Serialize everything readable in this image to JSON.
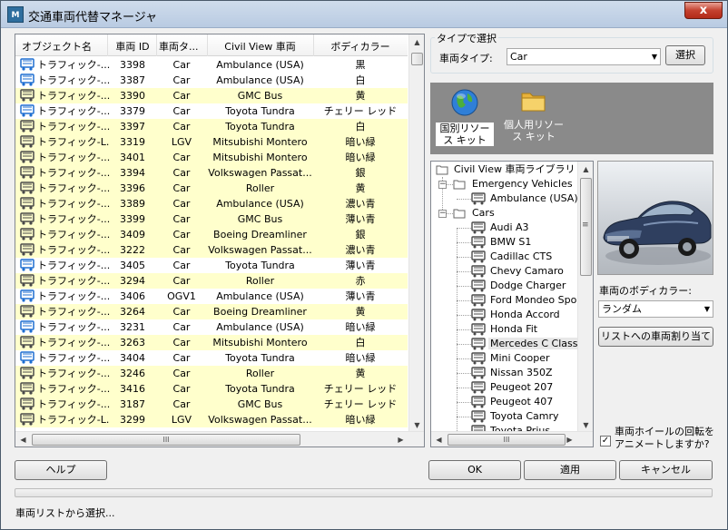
{
  "window": {
    "title": "交通車両代替マネージャ",
    "icon_text": "M",
    "close": "x"
  },
  "list": {
    "columns": [
      "オブジェクト名",
      "車両 ID",
      "車両タ...",
      "Civil View 車両",
      "ボディカラー"
    ],
    "rows": [
      {
        "name": "トラフィック-...",
        "id": "3398",
        "type": "Car",
        "civil": "Ambulance (USA)",
        "color": "黒",
        "hl": false,
        "icon": "blue"
      },
      {
        "name": "トラフィック-...",
        "id": "3387",
        "type": "Car",
        "civil": "Ambulance (USA)",
        "color": "白",
        "hl": false,
        "icon": "blue"
      },
      {
        "name": "トラフィック-...",
        "id": "3390",
        "type": "Car",
        "civil": "GMC Bus",
        "color": "黄",
        "hl": true,
        "icon": "gray"
      },
      {
        "name": "トラフィック-...",
        "id": "3379",
        "type": "Car",
        "civil": "Toyota Tundra",
        "color": "チェリー レッド",
        "hl": false,
        "icon": "blue"
      },
      {
        "name": "トラフィック-...",
        "id": "3397",
        "type": "Car",
        "civil": "Toyota Tundra",
        "color": "白",
        "hl": true,
        "icon": "gray"
      },
      {
        "name": "トラフィック-L...",
        "id": "3319",
        "type": "LGV",
        "civil": "Mitsubishi Montero",
        "color": "暗い緑",
        "hl": true,
        "icon": "gray"
      },
      {
        "name": "トラフィック-...",
        "id": "3401",
        "type": "Car",
        "civil": "Mitsubishi Montero",
        "color": "暗い緑",
        "hl": true,
        "icon": "gray"
      },
      {
        "name": "トラフィック-...",
        "id": "3394",
        "type": "Car",
        "civil": "Volkswagen Passat...",
        "color": "銀",
        "hl": true,
        "icon": "gray"
      },
      {
        "name": "トラフィック-...",
        "id": "3396",
        "type": "Car",
        "civil": "Roller",
        "color": "黄",
        "hl": true,
        "icon": "gray"
      },
      {
        "name": "トラフィック-...",
        "id": "3389",
        "type": "Car",
        "civil": "Ambulance (USA)",
        "color": "濃い青",
        "hl": true,
        "icon": "gray"
      },
      {
        "name": "トラフィック-...",
        "id": "3399",
        "type": "Car",
        "civil": "GMC Bus",
        "color": "薄い青",
        "hl": true,
        "icon": "gray"
      },
      {
        "name": "トラフィック-...",
        "id": "3409",
        "type": "Car",
        "civil": "Boeing Dreamliner",
        "color": "銀",
        "hl": true,
        "icon": "gray"
      },
      {
        "name": "トラフィック-...",
        "id": "3222",
        "type": "Car",
        "civil": "Volkswagen Passat...",
        "color": "濃い青",
        "hl": true,
        "icon": "gray"
      },
      {
        "name": "トラフィック-...",
        "id": "3405",
        "type": "Car",
        "civil": "Toyota Tundra",
        "color": "薄い青",
        "hl": false,
        "icon": "blue"
      },
      {
        "name": "トラフィック-...",
        "id": "3294",
        "type": "Car",
        "civil": "Roller",
        "color": "赤",
        "hl": true,
        "icon": "gray"
      },
      {
        "name": "トラフィック-...",
        "id": "3406",
        "type": "OGV1",
        "civil": "Ambulance (USA)",
        "color": "薄い青",
        "hl": false,
        "icon": "blue"
      },
      {
        "name": "トラフィック-...",
        "id": "3264",
        "type": "Car",
        "civil": "Boeing Dreamliner",
        "color": "黄",
        "hl": true,
        "icon": "gray"
      },
      {
        "name": "トラフィック-...",
        "id": "3231",
        "type": "Car",
        "civil": "Ambulance (USA)",
        "color": "暗い緑",
        "hl": false,
        "icon": "blue"
      },
      {
        "name": "トラフィック-...",
        "id": "3263",
        "type": "Car",
        "civil": "Mitsubishi Montero",
        "color": "白",
        "hl": true,
        "icon": "gray"
      },
      {
        "name": "トラフィック-...",
        "id": "3404",
        "type": "Car",
        "civil": "Toyota Tundra",
        "color": "暗い緑",
        "hl": false,
        "icon": "blue"
      },
      {
        "name": "トラフィック-...",
        "id": "3246",
        "type": "Car",
        "civil": "Roller",
        "color": "黄",
        "hl": true,
        "icon": "gray"
      },
      {
        "name": "トラフィック-...",
        "id": "3416",
        "type": "Car",
        "civil": "Toyota Tundra",
        "color": "チェリー レッド",
        "hl": true,
        "icon": "gray"
      },
      {
        "name": "トラフィック-...",
        "id": "3187",
        "type": "Car",
        "civil": "GMC Bus",
        "color": "チェリー レッド",
        "hl": true,
        "icon": "gray"
      },
      {
        "name": "トラフィック-L...",
        "id": "3299",
        "type": "LGV",
        "civil": "Volkswagen Passat...",
        "color": "暗い緑",
        "hl": true,
        "icon": "gray"
      }
    ],
    "hscroll_grip": "III"
  },
  "type_select": {
    "group_title": "タイプで選択",
    "label": "車両タイプ:",
    "value": "Car",
    "button": "選択"
  },
  "kits": [
    {
      "label": "国別リソース キット",
      "icon": "globe-icon",
      "selected": true
    },
    {
      "label": "個人用リソース キット",
      "icon": "folder-icon",
      "selected": false
    }
  ],
  "tree": {
    "root": "Civil View 車両ライブラリ",
    "items": [
      {
        "label": "Emergency Vehicles",
        "level": 1,
        "kind": "folder",
        "expander": "−"
      },
      {
        "label": "Ambulance (USA)",
        "level": 2,
        "kind": "vehicle"
      },
      {
        "label": "Cars",
        "level": 1,
        "kind": "folder",
        "expander": "−"
      },
      {
        "label": "Audi A3",
        "level": 2,
        "kind": "vehicle"
      },
      {
        "label": "BMW S1",
        "level": 2,
        "kind": "vehicle"
      },
      {
        "label": "Cadillac CTS",
        "level": 2,
        "kind": "vehicle"
      },
      {
        "label": "Chevy Camaro",
        "level": 2,
        "kind": "vehicle"
      },
      {
        "label": "Dodge Charger",
        "level": 2,
        "kind": "vehicle"
      },
      {
        "label": "Ford Mondeo Sportb",
        "level": 2,
        "kind": "vehicle"
      },
      {
        "label": "Honda Accord",
        "level": 2,
        "kind": "vehicle"
      },
      {
        "label": "Honda Fit",
        "level": 2,
        "kind": "vehicle"
      },
      {
        "label": "Mercedes C Class",
        "level": 2,
        "kind": "vehicle",
        "selected": true
      },
      {
        "label": "Mini Cooper",
        "level": 2,
        "kind": "vehicle"
      },
      {
        "label": "Nissan 350Z",
        "level": 2,
        "kind": "vehicle"
      },
      {
        "label": "Peugeot 207",
        "level": 2,
        "kind": "vehicle"
      },
      {
        "label": "Peugeot 407",
        "level": 2,
        "kind": "vehicle"
      },
      {
        "label": "Toyota Camry",
        "level": 2,
        "kind": "vehicle"
      },
      {
        "label": "Toyota Prius",
        "level": 2,
        "kind": "vehicle"
      }
    ],
    "hscroll_grip": "III",
    "vscroll_grip": "≡"
  },
  "body_color": {
    "label": "車両のボディカラー:",
    "value": "ランダム",
    "assign_button": "リストへの車両割り当て"
  },
  "wheel_anim": {
    "label_line1": "車両ホイールの回転を",
    "label_line2": "アニメートしますか?",
    "checked": true,
    "check_glyph": "✓"
  },
  "buttons": {
    "help": "ヘルプ",
    "ok": "OK",
    "apply": "適用",
    "cancel": "キャンセル"
  },
  "status": "車両リストから選択...",
  "colors": {
    "highlight_row": "#ffffcc",
    "kits_bg": "#8a8a8a",
    "blue_icon": "#1f6fd1"
  }
}
